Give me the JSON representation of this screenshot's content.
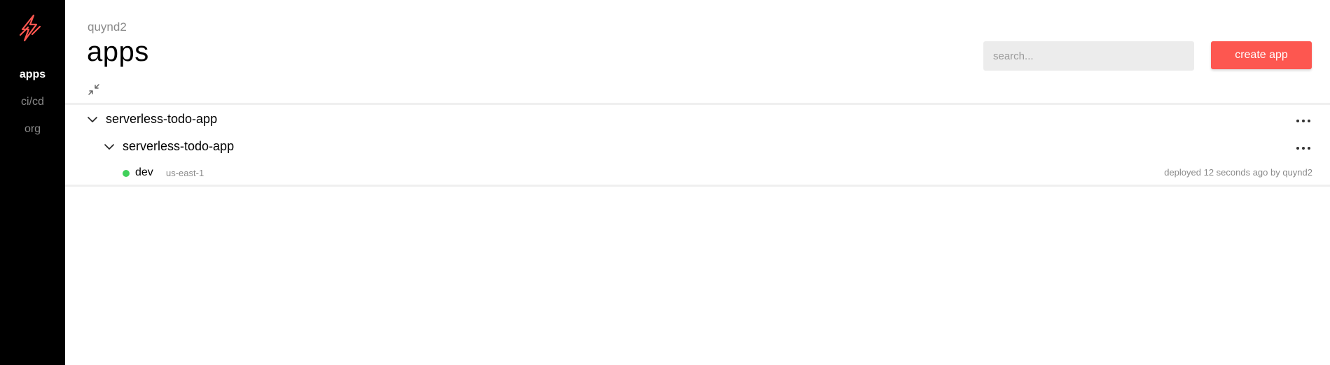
{
  "sidebar": {
    "logo_icon": "serverless-bolt-icon",
    "items": [
      {
        "label": "apps",
        "active": true
      },
      {
        "label": "ci/cd",
        "active": false
      },
      {
        "label": "org",
        "active": false
      }
    ]
  },
  "header": {
    "org_name": "quynd2",
    "title": "apps",
    "collapse_icon": "collapse-arrows-icon"
  },
  "search": {
    "placeholder": "search...",
    "value": ""
  },
  "toolbar": {
    "create_label": "create app"
  },
  "tree": {
    "app": {
      "name": "serverless-todo-app",
      "services": [
        {
          "name": "serverless-todo-app",
          "stages": [
            {
              "name": "dev",
              "region": "us-east-1",
              "deploy_info": "deployed 12 seconds ago by quynd2",
              "status": "success"
            }
          ]
        }
      ]
    }
  },
  "colors": {
    "accent": "#fd5750",
    "sidebar_bg": "#000000",
    "status_ok": "#41d15b",
    "muted_text": "#8a8a8a"
  }
}
